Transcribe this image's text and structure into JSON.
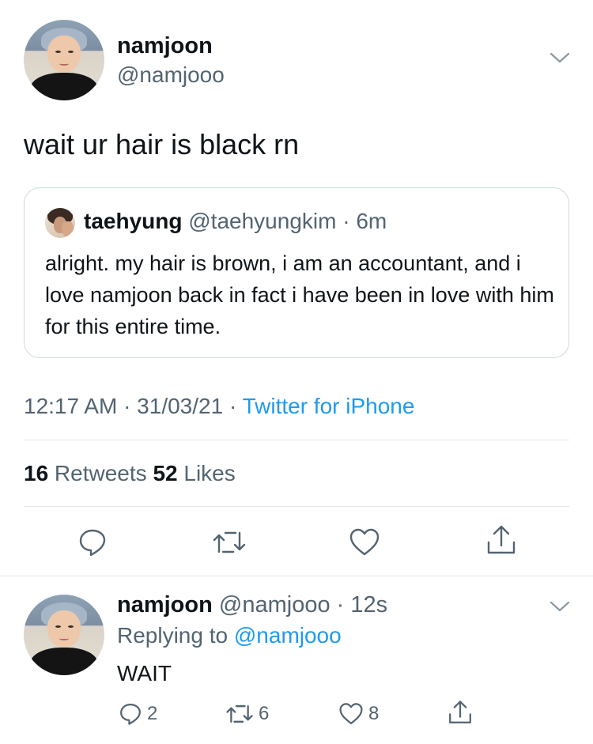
{
  "tweet": {
    "author_name": "namjoon",
    "author_handle": "@namjooo",
    "text": "wait ur hair is black rn",
    "timestamp": "12:17 AM · 31/03/21 · ",
    "source": "Twitter for iPhone",
    "retweets_count": "16",
    "retweets_label": " Retweets ",
    "likes_count": "52",
    "likes_label": " Likes"
  },
  "quoted": {
    "name": "taehyung",
    "handle": " @taehyungkim · 6m",
    "text": "alright. my hair is brown, i am an accountant, and i love namjoon back in fact i have been in love with him for this entire time."
  },
  "reply": {
    "name": "namjoon",
    "handle": " @namjooo · 12s",
    "replying_prefix": "Replying to ",
    "replying_to": "@namjooo",
    "text": "WAIT",
    "reply_count": "2",
    "retweet_count": "6",
    "like_count": "8"
  },
  "colors": {
    "text": "#0f1419",
    "secondary": "#536471",
    "link": "#1d9bf0",
    "border": "#cfd9de"
  },
  "icons": [
    "chevron-down-icon",
    "reply-icon",
    "retweet-icon",
    "like-icon",
    "share-icon"
  ]
}
